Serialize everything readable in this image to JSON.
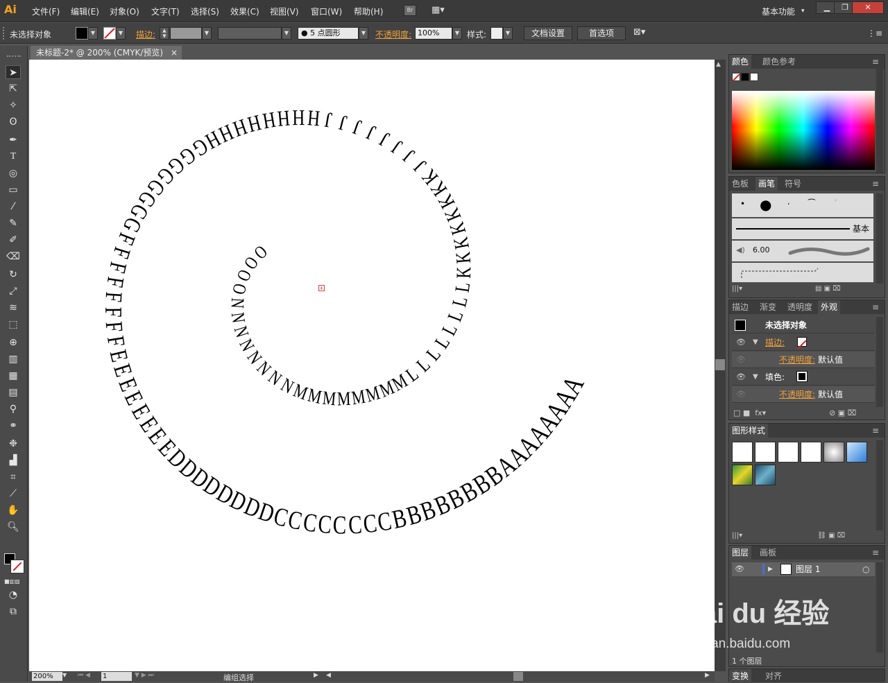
{
  "app": {
    "logo": "Ai"
  },
  "menu": [
    "文件(F)",
    "编辑(E)",
    "对象(O)",
    "文字(T)",
    "选择(S)",
    "效果(C)",
    "视图(V)",
    "窗口(W)",
    "帮助(H)"
  ],
  "bridge_label": "Br",
  "workspace": "基本功能",
  "control_bar": {
    "selection": "未选择对象",
    "stroke_label": "描边:",
    "brush_size": "5",
    "brush_name": "点圆形",
    "opacity_label": "不透明度:",
    "opacity_value": "100%",
    "style_label": "样式:",
    "doc_setup": "文档设置",
    "preferences": "首选项"
  },
  "document_tab": {
    "title": "未标题-2* @ 200% (CMYK/预览)",
    "close": "×"
  },
  "spiral_text": "AAAAAAAABBBBBBBBCCCCCCCCDDDDDDDDEEEEEEEEFFFFFFFFGGGGGGGGHHHHHHHHJJJJJJJJKKKKKKKKLLLLLLLLMMMMMMMMNNNNNNNNOOOO",
  "status": {
    "zoom": "200%",
    "page": "1",
    "mode": "编组选择"
  },
  "panels": {
    "color": {
      "tabs": [
        "颜色",
        "颜色参考"
      ]
    },
    "brushes": {
      "tabs": [
        "色板",
        "画笔",
        "符号"
      ],
      "basic": "基本",
      "size": "6.00"
    },
    "appearance": {
      "tabs": [
        "描边",
        "渐变",
        "透明度",
        "外观"
      ],
      "header": "未选择对象",
      "rows": [
        {
          "label": "描边:",
          "value": ""
        },
        {
          "label": "不透明度:",
          "value": "默认值"
        },
        {
          "label": "填色:",
          "value": ""
        },
        {
          "label": "不透明度:",
          "value": "默认值"
        }
      ]
    },
    "graphic_styles": {
      "tabs": [
        "图形样式"
      ]
    },
    "layers": {
      "tabs": [
        "图层",
        "画板"
      ],
      "layer_name": "图层 1",
      "footer": "1 个图层"
    },
    "bottom": {
      "tabs": [
        "变换",
        "对齐"
      ]
    }
  },
  "watermark": {
    "brand": "Bai du 经验",
    "url": "jingyan.baidu.com"
  }
}
